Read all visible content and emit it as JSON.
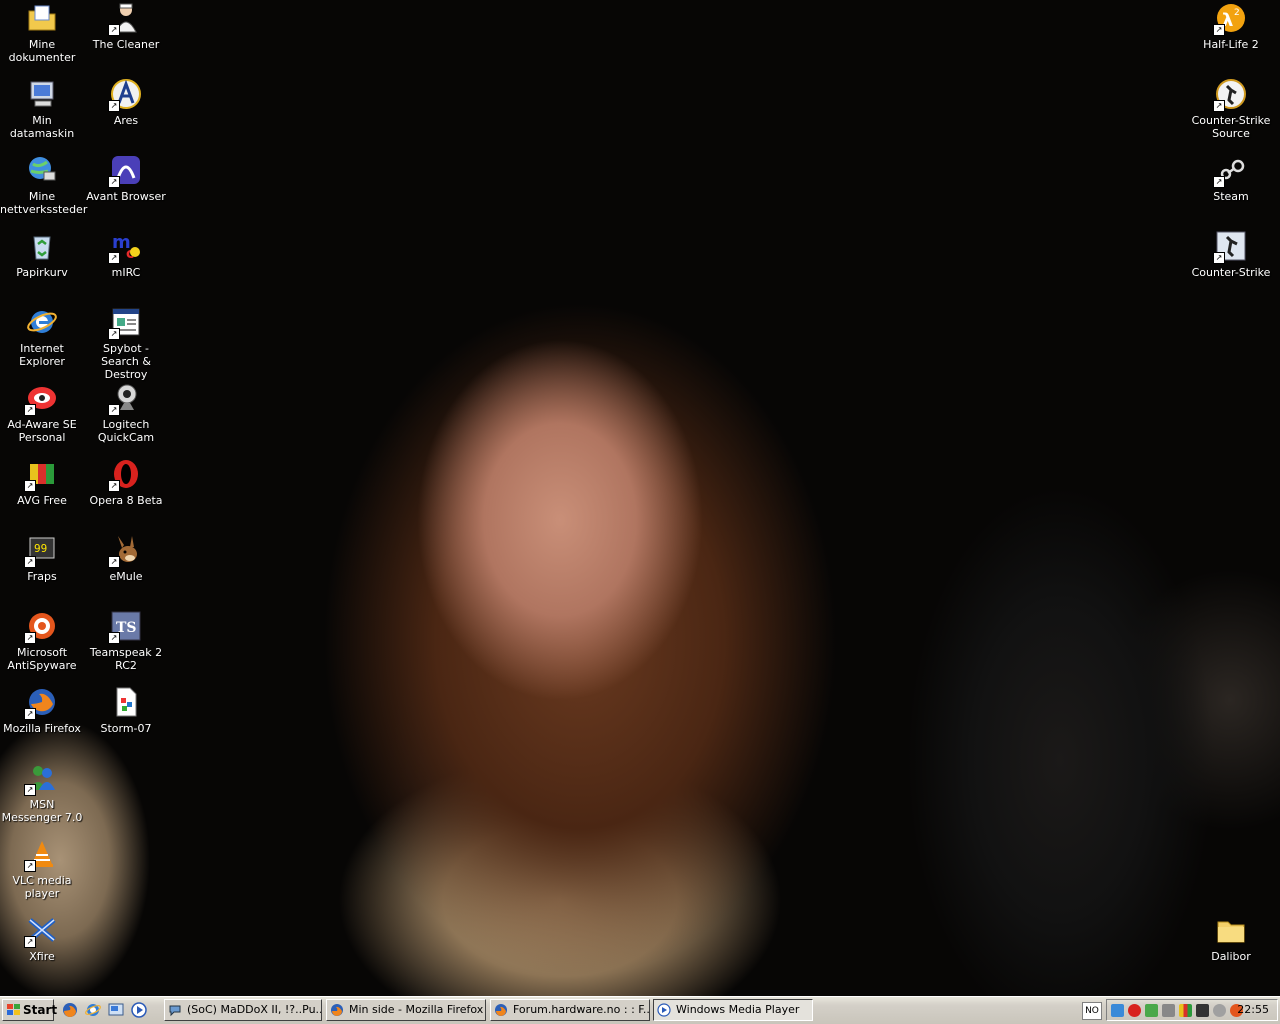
{
  "desktop": {
    "left_icons": [
      {
        "label": "Mine dokumenter",
        "icon": "my-documents-folder-icon"
      },
      {
        "label": "The Cleaner",
        "icon": "the-cleaner-icon"
      },
      {
        "label": "Min datamaskin",
        "icon": "my-computer-icon"
      },
      {
        "label": "Ares",
        "icon": "ares-icon"
      },
      {
        "label": "Mine nettverkssteder",
        "icon": "network-places-icon"
      },
      {
        "label": "Avant Browser",
        "icon": "avant-browser-icon"
      },
      {
        "label": "Papirkurv",
        "icon": "recycle-bin-icon"
      },
      {
        "label": "mIRC",
        "icon": "mirc-icon"
      },
      {
        "label": "Internet Explorer",
        "icon": "internet-explorer-icon"
      },
      {
        "label": "Spybot - Search & Destroy",
        "icon": "spybot-icon"
      },
      {
        "label": "Ad-Aware SE Personal",
        "icon": "ad-aware-icon"
      },
      {
        "label": "Logitech QuickCam",
        "icon": "logitech-quickcam-icon"
      },
      {
        "label": "AVG Free",
        "icon": "avg-icon"
      },
      {
        "label": "Opera 8 Beta",
        "icon": "opera-icon"
      },
      {
        "label": "Fraps",
        "icon": "fraps-icon"
      },
      {
        "label": "eMule",
        "icon": "emule-icon"
      },
      {
        "label": "Microsoft AntiSpyware",
        "icon": "antispyware-icon"
      },
      {
        "label": "Teamspeak 2 RC2",
        "icon": "teamspeak-icon"
      },
      {
        "label": "Mozilla Firefox",
        "icon": "firefox-icon"
      },
      {
        "label": "Storm-07",
        "icon": "storm-document-icon"
      },
      {
        "label": "MSN Messenger 7.0",
        "icon": "msn-messenger-icon"
      },
      {
        "label": "VLC media player",
        "icon": "vlc-icon"
      },
      {
        "label": "Xfire",
        "icon": "xfire-icon"
      }
    ],
    "right_icons": [
      {
        "label": "Half-Life 2",
        "icon": "half-life-2-icon"
      },
      {
        "label": "Counter-Strike Source",
        "icon": "counter-strike-source-icon"
      },
      {
        "label": "Steam",
        "icon": "steam-icon"
      },
      {
        "label": "Counter-Strike",
        "icon": "counter-strike-icon"
      },
      {
        "label": "Dalibor",
        "icon": "folder-icon"
      }
    ]
  },
  "taskbar": {
    "start_label": "Start",
    "quick_launch": [
      "firefox-icon",
      "ie-icon",
      "show-desktop-icon",
      "media-player-icon"
    ],
    "tasks": [
      {
        "label": "(SoC) MaDDoX II, !?..Pu...",
        "icon": "chat-icon",
        "active": false
      },
      {
        "label": "Min side - Mozilla Firefox",
        "icon": "firefox-icon",
        "active": false
      },
      {
        "label": "Forum.hardware.no : : F...",
        "icon": "firefox-icon",
        "active": false
      },
      {
        "label": "Windows Media Player",
        "icon": "media-player-icon",
        "active": true
      }
    ],
    "language": "NO",
    "tray_icons": [
      "msn-tray-icon",
      "opera-tray-icon",
      "network-tray-icon",
      "volume-tray-icon",
      "avg-tray-icon",
      "shield-tray-icon",
      "cam-tray-icon",
      "antispyware-tray-icon"
    ],
    "clock": "22:55"
  },
  "colors": {
    "desktop_bg": "#070605",
    "taskbar_bg": "#d4d0c8",
    "label_text": "#ffffff"
  }
}
